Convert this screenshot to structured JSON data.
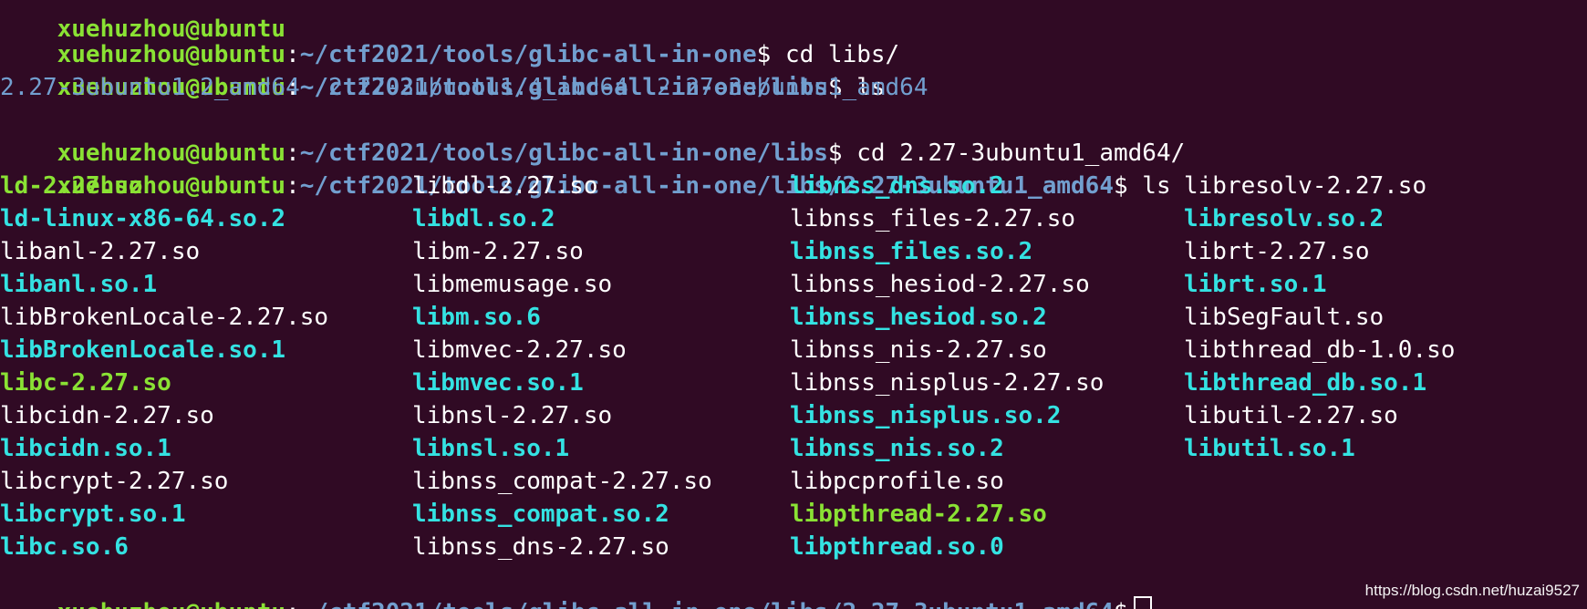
{
  "terminal": {
    "prompt_user": "xuehuzhou@ubuntu",
    "prompt_sep": ":",
    "paths": {
      "p1": "~/ctf2021/tools/glibc-all-in-one",
      "p2": "~/ctf2021/tools/glibc-all-in-one/libs",
      "p3": "~/ctf2021/tools/glibc-all-in-one/libs",
      "p4": "~/ctf2021/tools/glibc-all-in-one/libs/2.27-3ubuntu1_amd64",
      "p5": "~/ctf2021/tools/glibc-all-in-one/libs/2.27-3ubuntu1_amd64"
    },
    "prompt_symbol": "$",
    "commands": {
      "c1": " cd libs/",
      "c2": " ls",
      "c3": " cd 2.27-3ubuntu1_amd64/",
      "c4": " ls"
    },
    "ls_libs_output": "2.27-3ubuntu1.2_amd64  2.27-3ubuntu1.4_amd64  2.27-3ubuntu1_amd64",
    "files": {
      "col1": [
        {
          "name": "ld-2.27.so",
          "type": "exec"
        },
        {
          "name": "ld-linux-x86-64.so.2",
          "type": "link"
        },
        {
          "name": "libanl-2.27.so",
          "type": "regular"
        },
        {
          "name": "libanl.so.1",
          "type": "link"
        },
        {
          "name": "libBrokenLocale-2.27.so",
          "type": "regular"
        },
        {
          "name": "libBrokenLocale.so.1",
          "type": "link"
        },
        {
          "name": "libc-2.27.so",
          "type": "exec"
        },
        {
          "name": "libcidn-2.27.so",
          "type": "regular"
        },
        {
          "name": "libcidn.so.1",
          "type": "link"
        },
        {
          "name": "libcrypt-2.27.so",
          "type": "regular"
        },
        {
          "name": "libcrypt.so.1",
          "type": "link"
        },
        {
          "name": "libc.so.6",
          "type": "link"
        }
      ],
      "col2": [
        {
          "name": "libdl-2.27.so",
          "type": "regular"
        },
        {
          "name": "libdl.so.2",
          "type": "link"
        },
        {
          "name": "libm-2.27.so",
          "type": "regular"
        },
        {
          "name": "libmemusage.so",
          "type": "regular"
        },
        {
          "name": "libm.so.6",
          "type": "link"
        },
        {
          "name": "libmvec-2.27.so",
          "type": "regular"
        },
        {
          "name": "libmvec.so.1",
          "type": "link"
        },
        {
          "name": "libnsl-2.27.so",
          "type": "regular"
        },
        {
          "name": "libnsl.so.1",
          "type": "link"
        },
        {
          "name": "libnss_compat-2.27.so",
          "type": "regular"
        },
        {
          "name": "libnss_compat.so.2",
          "type": "link"
        },
        {
          "name": "libnss_dns-2.27.so",
          "type": "regular"
        }
      ],
      "col3": [
        {
          "name": "libnss_dns.so.2",
          "type": "link"
        },
        {
          "name": "libnss_files-2.27.so",
          "type": "regular"
        },
        {
          "name": "libnss_files.so.2",
          "type": "link"
        },
        {
          "name": "libnss_hesiod-2.27.so",
          "type": "regular"
        },
        {
          "name": "libnss_hesiod.so.2",
          "type": "link"
        },
        {
          "name": "libnss_nis-2.27.so",
          "type": "regular"
        },
        {
          "name": "libnss_nisplus-2.27.so",
          "type": "regular"
        },
        {
          "name": "libnss_nisplus.so.2",
          "type": "link"
        },
        {
          "name": "libnss_nis.so.2",
          "type": "link"
        },
        {
          "name": "libpcprofile.so",
          "type": "regular"
        },
        {
          "name": "libpthread-2.27.so",
          "type": "exec"
        },
        {
          "name": "libpthread.so.0",
          "type": "link"
        }
      ],
      "col4": [
        {
          "name": "libresolv-2.27.so",
          "type": "regular"
        },
        {
          "name": "libresolv.so.2",
          "type": "link"
        },
        {
          "name": "librt-2.27.so",
          "type": "regular"
        },
        {
          "name": "librt.so.1",
          "type": "link"
        },
        {
          "name": "libSegFault.so",
          "type": "regular"
        },
        {
          "name": "libthread_db-1.0.so",
          "type": "regular"
        },
        {
          "name": "libthread_db.so.1",
          "type": "link"
        },
        {
          "name": "libutil-2.27.so",
          "type": "regular"
        },
        {
          "name": "libutil.so.1",
          "type": "link"
        }
      ]
    },
    "colors": {
      "background": "#300a24",
      "user": "#8ae234",
      "path": "#729fcf",
      "link": "#34e2e2",
      "exec": "#8ae234",
      "text": "#ffffff"
    }
  },
  "watermark": "https://blog.csdn.net/huzai9527"
}
